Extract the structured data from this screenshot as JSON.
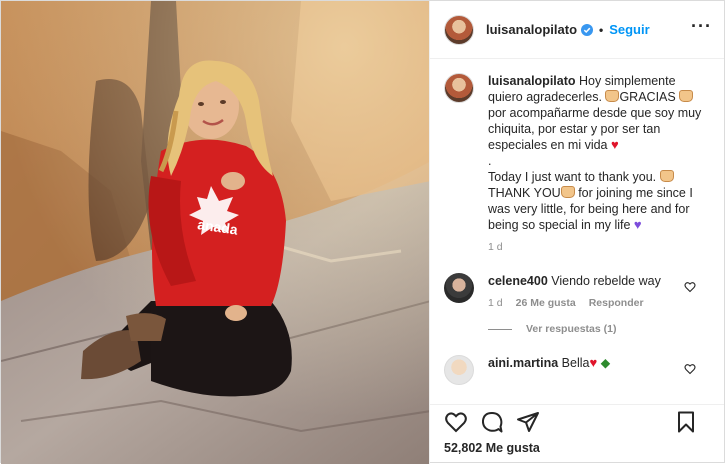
{
  "header": {
    "username": "luisanalopilato",
    "separator": "•",
    "follow_label": "Seguir",
    "more_icon": "more-horizontal-icon"
  },
  "caption": {
    "username": "luisanalopilato",
    "text": "Hoy simplemente quiero agradecerles.",
    "text2": "GRACIAS",
    "text3": "por acompañarme desde que soy muy chiquita, por estar y por ser tan especiales en mi vida",
    "dot": ".",
    "text4": "Today I just want to thank you.",
    "text5": "THANK YOU",
    "text6": "for joining me since I was very little, for being here and for being so special in my life",
    "time": "1 d"
  },
  "comments": [
    {
      "username": "celene400",
      "text": "Viendo rebelde way",
      "time": "1 d",
      "likes": "26 Me gusta",
      "reply": "Responder"
    },
    {
      "username": "aini.martina",
      "text": "Bella"
    }
  ],
  "view_replies": "Ver respuestas (1)",
  "actions": {
    "icons": [
      "heart-icon",
      "comment-icon",
      "share-icon",
      "bookmark-icon"
    ],
    "likes_count": "52,802 Me gusta"
  },
  "colors": {
    "link_blue": "#0095f6",
    "muted": "#8e8e8e",
    "text": "#262626",
    "heart_red": "#e0142b",
    "heart_purple": "#7c4ddb",
    "hoodie_red": "#d42020"
  }
}
